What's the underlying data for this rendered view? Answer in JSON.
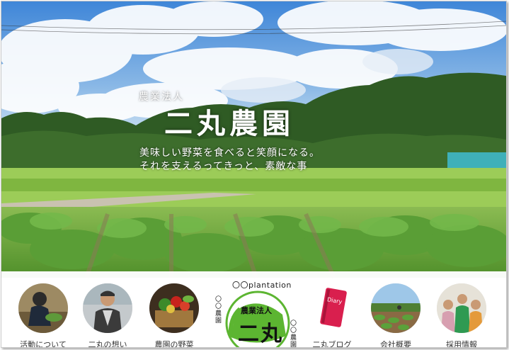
{
  "hero": {
    "tagline_small": "農業法人",
    "title": "二丸農園",
    "subtitle_line1": "美味しい野菜を食べると笑顔になる。",
    "subtitle_line2": "それを支えるってきっと、素敵な事"
  },
  "nav": {
    "items": [
      {
        "label": "活動について",
        "icon": "farmer-photo-icon"
      },
      {
        "label": "二丸の想い",
        "icon": "owner-photo-icon"
      },
      {
        "label": "農園の野菜",
        "icon": "vegetables-photo-icon"
      },
      {
        "label": "二丸ブログ",
        "icon": "diary-book-icon"
      },
      {
        "label": "会社概要",
        "icon": "field-photo-icon"
      },
      {
        "label": "採用情報",
        "icon": "staff-photo-icon"
      }
    ],
    "diary_text": "Diary"
  },
  "logo": {
    "arc_text": "〇〇plantation",
    "side_left": "〇〇農園",
    "side_right": "〇〇農園",
    "inner_top": "農業法人",
    "inner_main": "二丸",
    "brand_color": "#5cb531"
  }
}
